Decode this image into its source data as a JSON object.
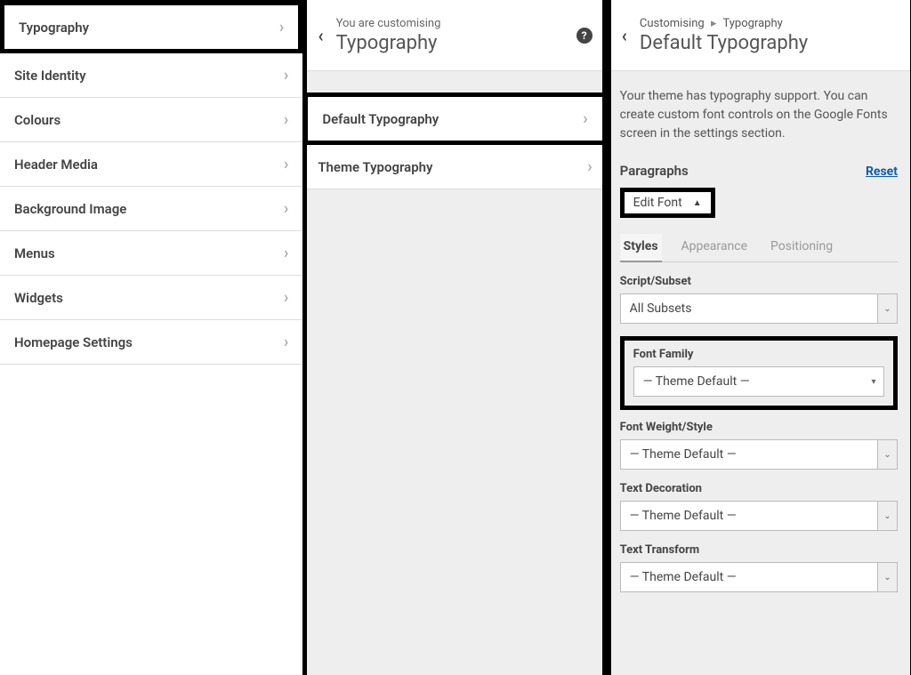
{
  "panel1": {
    "items": [
      "Typography",
      "Site Identity",
      "Colours",
      "Header Media",
      "Background Image",
      "Menus",
      "Widgets",
      "Homepage Settings"
    ]
  },
  "panel2": {
    "subhead": "You are customising",
    "title": "Typography",
    "items": [
      "Default Typography",
      "Theme Typography"
    ]
  },
  "panel3": {
    "breadcrumb_a": "Customising",
    "breadcrumb_b": "Typography",
    "title": "Default Typography",
    "description": "Your theme has typography support. You can create custom font controls on the Google Fonts screen in the settings section.",
    "section_label": "Paragraphs",
    "reset": "Reset",
    "edit_font": "Edit Font",
    "tabs": [
      "Styles",
      "Appearance",
      "Positioning"
    ],
    "fields": {
      "script_subset": {
        "label": "Script/Subset",
        "value": "All Subsets"
      },
      "font_family": {
        "label": "Font Family",
        "value": "— Theme Default —"
      },
      "font_weight": {
        "label": "Font Weight/Style",
        "value": "— Theme Default —"
      },
      "text_decoration": {
        "label": "Text Decoration",
        "value": "— Theme Default —"
      },
      "text_transform": {
        "label": "Text Transform",
        "value": "— Theme Default —"
      }
    }
  }
}
